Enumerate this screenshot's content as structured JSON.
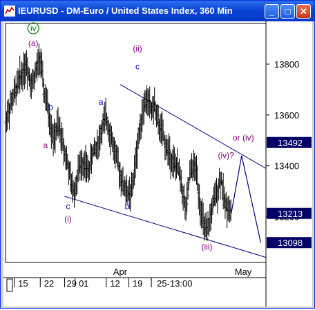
{
  "window": {
    "title": "IEURUSD - DM-Euro / United States Index, 360 Min",
    "minimize_label": "_",
    "maximize_label": "□",
    "close_label": "✕"
  },
  "chart_data": {
    "type": "ohlc",
    "title": "",
    "y_ticks": [
      {
        "label": "13800",
        "value": 13800
      },
      {
        "label": "13600",
        "value": 13600
      },
      {
        "label": "13400",
        "value": 13400
      },
      {
        "label": "13200",
        "value": 13200
      }
    ],
    "ylim": [
      13020,
      13960
    ],
    "price_boxes": [
      {
        "label": "13492",
        "value": 13492
      },
      {
        "label": "13213",
        "value": 13213
      },
      {
        "label": "13098",
        "value": 13098
      }
    ],
    "x_top_labels": [
      "Apr",
      "May"
    ],
    "x_bottom_labels": [
      "15",
      "22",
      "29",
      "01",
      "12",
      "19",
      "25-13:00"
    ],
    "wave_labels": [
      {
        "text": "iv",
        "color": "#008000",
        "circled": true
      },
      {
        "text": "(a)",
        "color": "#800080"
      },
      {
        "text": "b",
        "color": "#0000c0"
      },
      {
        "text": "a",
        "color": "#800080"
      },
      {
        "text": "c",
        "color": "#0000c0"
      },
      {
        "text": "(i)",
        "color": "#800080"
      },
      {
        "text": "a",
        "color": "#0000c0"
      },
      {
        "text": "b",
        "color": "#0000c0"
      },
      {
        "text": "(ii)",
        "color": "#800080"
      },
      {
        "text": "c",
        "color": "#0000c0"
      },
      {
        "text": "(iii)",
        "color": "#800080"
      },
      {
        "text": "(iv)?",
        "color": "#800080"
      },
      {
        "text": "or (iv)",
        "color": "#800080"
      }
    ],
    "close_path": [
      [
        0,
        13580
      ],
      [
        4,
        13660
      ],
      [
        8,
        13740
      ],
      [
        12,
        13800
      ],
      [
        15,
        13720
      ],
      [
        18,
        13780
      ],
      [
        20,
        13830
      ],
      [
        22,
        13700
      ],
      [
        24,
        13640
      ],
      [
        26,
        13560
      ],
      [
        28,
        13500
      ],
      [
        30,
        13560
      ],
      [
        32,
        13520
      ],
      [
        34,
        13460
      ],
      [
        36,
        13400
      ],
      [
        38,
        13320
      ],
      [
        40,
        13300
      ],
      [
        42,
        13380
      ],
      [
        44,
        13420
      ],
      [
        46,
        13400
      ],
      [
        48,
        13380
      ],
      [
        50,
        13450
      ],
      [
        52,
        13470
      ],
      [
        54,
        13500
      ],
      [
        56,
        13560
      ],
      [
        58,
        13590
      ],
      [
        60,
        13540
      ],
      [
        62,
        13480
      ],
      [
        64,
        13430
      ],
      [
        66,
        13370
      ],
      [
        68,
        13320
      ],
      [
        70,
        13300
      ],
      [
        72,
        13280
      ],
      [
        74,
        13360
      ],
      [
        76,
        13480
      ],
      [
        78,
        13580
      ],
      [
        80,
        13640
      ],
      [
        82,
        13660
      ],
      [
        84,
        13620
      ],
      [
        86,
        13640
      ],
      [
        88,
        13560
      ],
      [
        90,
        13540
      ],
      [
        92,
        13480
      ],
      [
        94,
        13460
      ],
      [
        96,
        13420
      ],
      [
        98,
        13400
      ],
      [
        100,
        13380
      ],
      [
        102,
        13300
      ],
      [
        104,
        13220
      ],
      [
        106,
        13360
      ],
      [
        108,
        13400
      ],
      [
        110,
        13380
      ],
      [
        112,
        13250
      ],
      [
        114,
        13170
      ],
      [
        116,
        13130
      ],
      [
        118,
        13200
      ],
      [
        120,
        13260
      ],
      [
        122,
        13300
      ],
      [
        124,
        13360
      ],
      [
        126,
        13260
      ],
      [
        128,
        13240
      ],
      [
        130,
        13213
      ]
    ],
    "projection": [
      [
        130,
        13213
      ],
      [
        136,
        13440
      ],
      [
        147,
        13098
      ]
    ],
    "trendlines": [
      {
        "from": [
          66,
          13720
        ],
        "to": [
          150,
          13390
        ]
      },
      {
        "from": [
          34,
          13280
        ],
        "to": [
          150,
          13040
        ]
      }
    ]
  }
}
